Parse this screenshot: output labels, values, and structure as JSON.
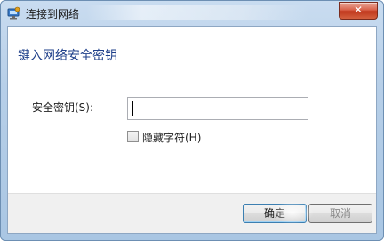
{
  "window": {
    "title": "连接到网络",
    "close_label": "✕"
  },
  "dialog": {
    "heading": "键入网络安全密钥",
    "security_key_label": "安全密钥(S):",
    "security_key_value": "",
    "hide_characters_label": "隐藏字符(H)",
    "hide_characters_checked": false
  },
  "buttons": {
    "ok_label": "确定",
    "cancel_label": "取消"
  },
  "colors": {
    "heading": "#1e3f8a",
    "close_button": "#c0381d"
  }
}
